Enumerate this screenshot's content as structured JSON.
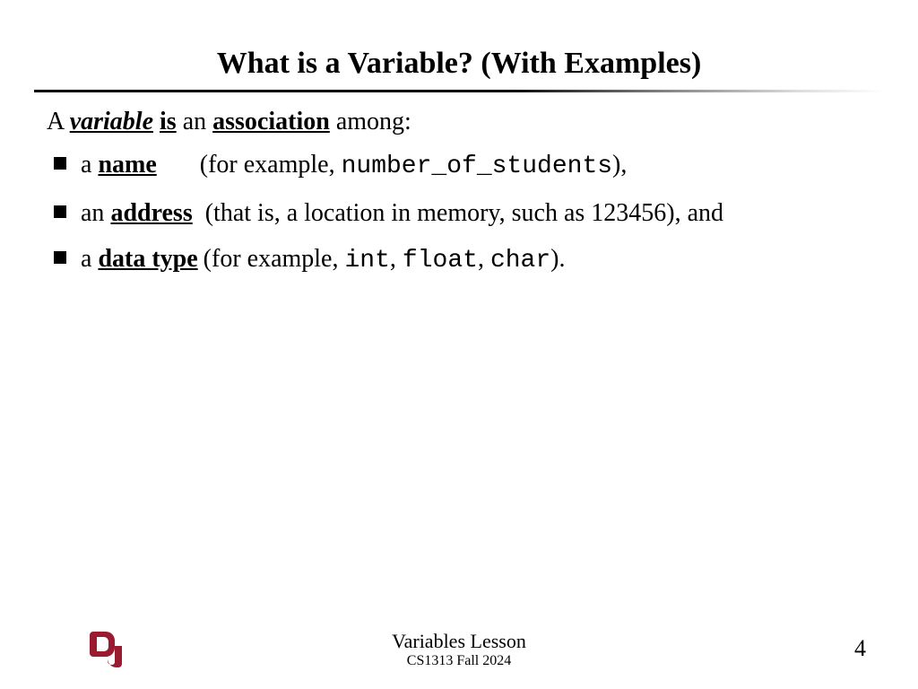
{
  "title": "What is a Variable? (With Examples)",
  "intro": {
    "t1": "A ",
    "variable": "variable",
    "t2": " ",
    "is": "is",
    "t3": " an ",
    "association": "association",
    "t4": " among:"
  },
  "bullets": [
    {
      "t1": "a ",
      "kw": "name",
      "pad": "        ",
      "t2": "(for example, ",
      "code": "number_of_students",
      "t3": "),"
    },
    {
      "t1": "an ",
      "kw": "address",
      "pad": "  ",
      "t2": "(that is, a location in memory, such as 123456), and"
    },
    {
      "t1": "a ",
      "kw": "data type",
      "pad": " ",
      "t2": "(for example, ",
      "code1": "int",
      "sep1": ", ",
      "code2": "float",
      "sep2": ", ",
      "code3": "char",
      "t3": ")."
    }
  ],
  "footer": {
    "lesson": "Variables Lesson",
    "course": "CS1313 Fall 2024",
    "page": "4"
  }
}
